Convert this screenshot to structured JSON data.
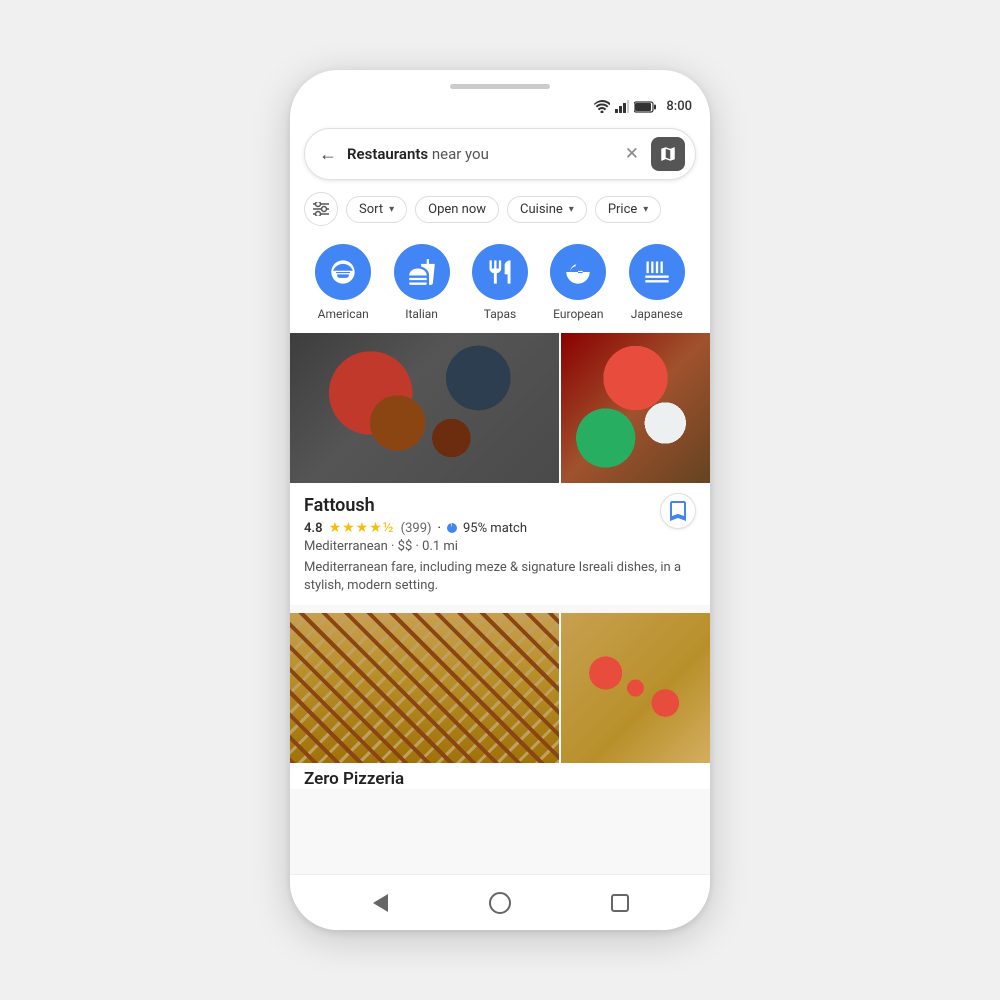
{
  "phone": {
    "status_bar": {
      "time": "8:00"
    },
    "search": {
      "query_bold": "Restaurants",
      "query_light": " near you",
      "back_label": "←",
      "clear_label": "✕"
    },
    "filters": {
      "filter_icon_label": "⚙",
      "chips": [
        {
          "id": "sort",
          "label": "Sort",
          "has_arrow": true
        },
        {
          "id": "open_now",
          "label": "Open now",
          "has_arrow": false
        },
        {
          "id": "cuisine",
          "label": "Cuisine",
          "has_arrow": true
        },
        {
          "id": "price",
          "label": "Price",
          "has_arrow": true
        }
      ]
    },
    "categories": [
      {
        "id": "american",
        "label": "American",
        "icon": "burger"
      },
      {
        "id": "italian",
        "label": "Italian",
        "icon": "fork"
      },
      {
        "id": "tapas",
        "label": "Tapas",
        "icon": "cutlery"
      },
      {
        "id": "european",
        "label": "European",
        "icon": "bowl"
      },
      {
        "id": "japanese",
        "label": "Japanese",
        "icon": "noodles"
      }
    ],
    "restaurants": [
      {
        "id": "fattoush",
        "name": "Fattoush",
        "rating": "4.8",
        "stars": "★★★★½",
        "review_count": "(399)",
        "match_pct": "95% match",
        "meta": "Mediterranean · $$ · 0.1 mi",
        "description": "Mediterranean fare, including meze & signature Isreali dishes, in a stylish, modern setting."
      },
      {
        "id": "zero-pizzeria",
        "name": "Zero Pizzeria",
        "rating": "",
        "stars": "",
        "review_count": "",
        "match_pct": "",
        "meta": "",
        "description": ""
      }
    ],
    "nav": {
      "back": "back",
      "home": "home",
      "recents": "recents"
    }
  }
}
